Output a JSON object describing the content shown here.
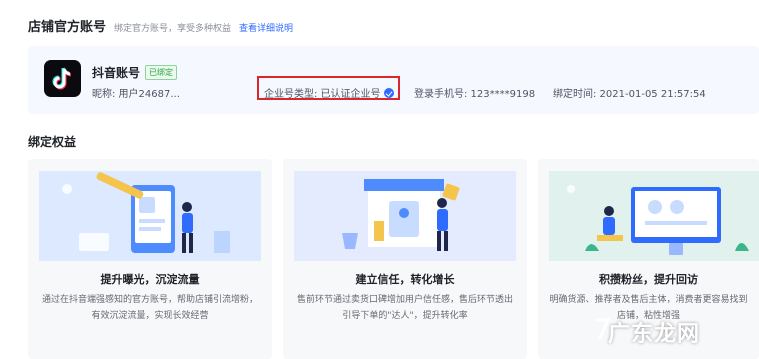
{
  "section": {
    "title": "店铺官方账号",
    "desc": "绑定官方账号，享受多种权益",
    "link": "查看详细说明"
  },
  "account": {
    "name": "抖音账号",
    "badge": "已绑定",
    "nickname": "昵称: 用户24687...",
    "enterprise_type": "企业号类型: 已认证企业号",
    "phone": "登录手机号: 123****9198",
    "bind_time": "绑定时间: 2021-01-05 21:57:54"
  },
  "benefits": {
    "title": "绑定权益",
    "cards": [
      {
        "title": "提升曝光，沉淀流量",
        "desc": "通过在抖音端强感知的官方账号，帮助店铺引流增粉，有效沉淀流量，实现长效经营"
      },
      {
        "title": "建立信任，转化增长",
        "desc": "售前环节通过卖货口碑增加用户信任感，售后环节透出引导下单的\"达人\"，提升转化率"
      },
      {
        "title": "积攒粉丝，提升回访",
        "desc": "明确货源、推荐者及售后主体，消费者更容易找到店铺，粘性增强"
      }
    ]
  },
  "watermark": "广东龙网",
  "colors": {
    "accent": "#2f6bff",
    "highlight": "#d9272b",
    "badge": "#2fa343"
  }
}
